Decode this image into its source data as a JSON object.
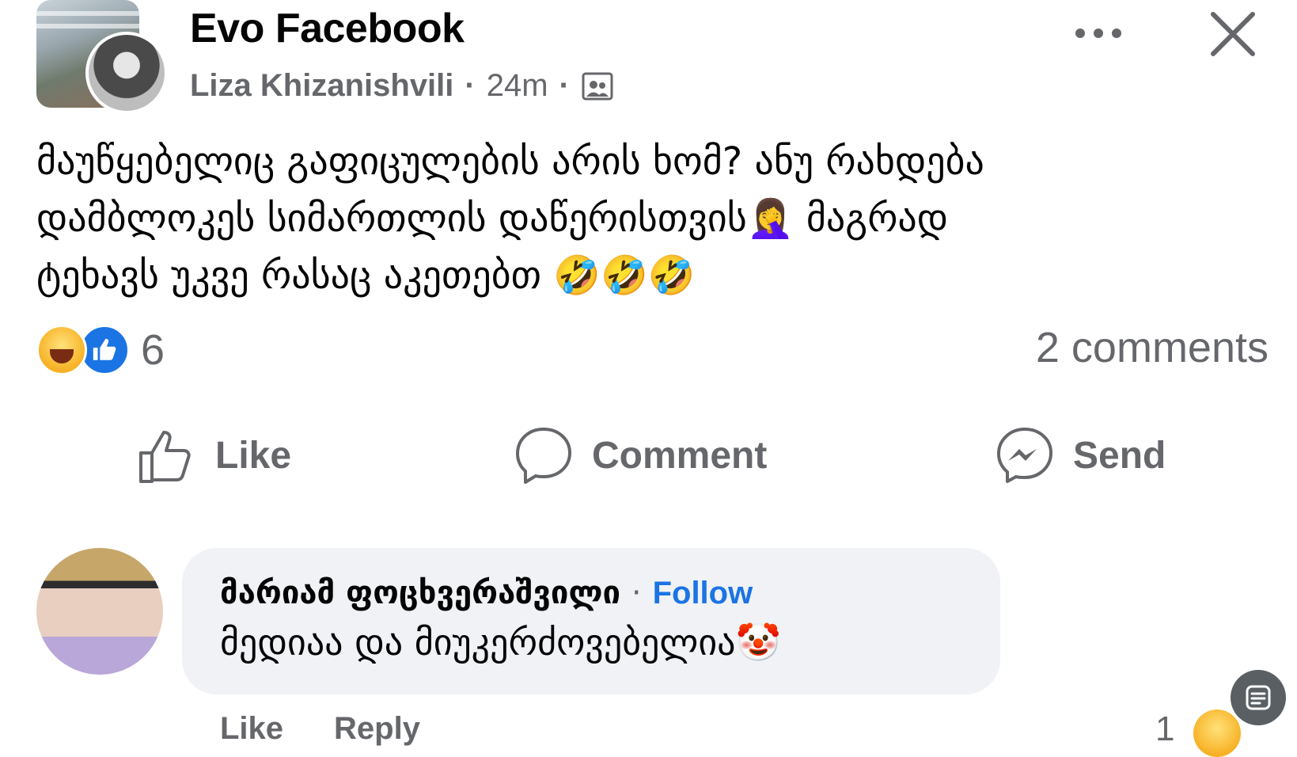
{
  "header": {
    "group_name": "Evo Facebook",
    "author": "Liza Khizanishvili",
    "separator": "·",
    "time": "24m",
    "privacy_icon": "group-members-icon"
  },
  "post": {
    "text": "მაუწყებელიც გაფიცულების არის ხომ? ანუ რახდება\nდამბლოკეს სიმართლის დაწერისთვის🤦‍♀️ მაგრად\nტეხავს უკვე რასაც აკეთებთ 🤣🤣🤣"
  },
  "reactions": {
    "types": [
      "haha",
      "like"
    ],
    "count": "6",
    "comments_label": "2 comments"
  },
  "actions": {
    "like": "Like",
    "comment": "Comment",
    "send": "Send"
  },
  "comment": {
    "author": "მარიამ ფოცხვერაშვილი",
    "separator": "·",
    "follow_label": "Follow",
    "text": "მედიაა და მიუკერძოვებელია🤡",
    "like_label": "Like",
    "reply_label": "Reply",
    "reaction_count": "1"
  },
  "colors": {
    "accent": "#1b74e4",
    "secondary_text": "#65676b",
    "bubble": "#f0f2f5"
  }
}
